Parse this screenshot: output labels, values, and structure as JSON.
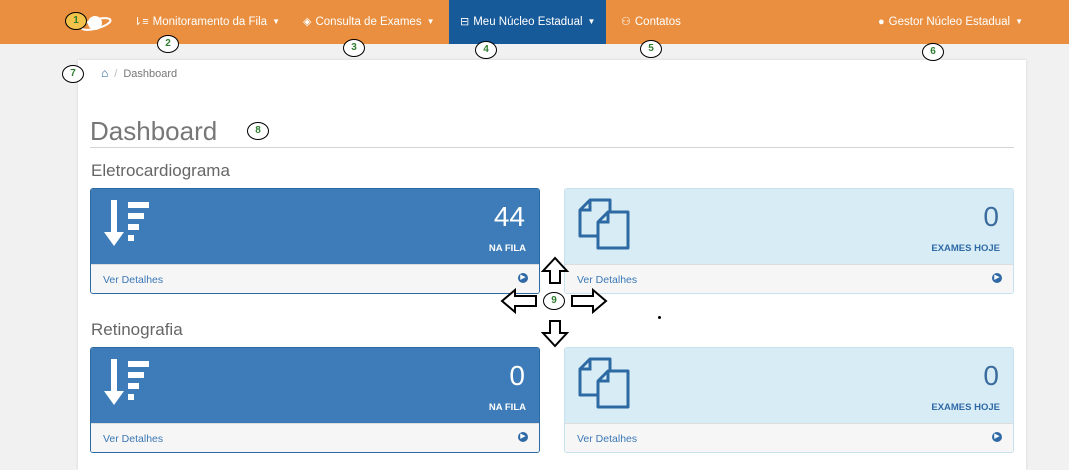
{
  "colors": {
    "navbar": "#e98f3f",
    "nav_active": "#175a99",
    "card_blue": "#3d7cb8",
    "card_light": "#d8ecf5",
    "link": "#3b78b6"
  },
  "navbar": {
    "logo_icon": "planet-logo-icon",
    "items": [
      {
        "label": "Monitoramento da Fila",
        "icon": "sort-down-icon",
        "dropdown": true
      },
      {
        "label": "Consulta de Exames",
        "icon": "layers-icon",
        "dropdown": true
      },
      {
        "label": "Meu Núcleo Estadual",
        "icon": "tray-icon",
        "dropdown": true,
        "active": true
      },
      {
        "label": "Contatos",
        "icon": "users-icon",
        "dropdown": false
      }
    ],
    "user": {
      "label": "Gestor Núcleo Estadual",
      "icon": "user-icon",
      "dropdown": true
    }
  },
  "breadcrumb": {
    "home_icon": "home-icon",
    "separator": "/",
    "current": "Dashboard"
  },
  "page": {
    "title": "Dashboard"
  },
  "sections": [
    {
      "title": "Eletrocardiograma",
      "queue": {
        "value": "44",
        "caption": "NA FILA",
        "link": "Ver Detalhes"
      },
      "today": {
        "value": "0",
        "caption": "EXAMES HOJE",
        "link": "Ver Detalhes"
      }
    },
    {
      "title": "Retinografia",
      "queue": {
        "value": "0",
        "caption": "NA FILA",
        "link": "Ver Detalhes"
      },
      "today": {
        "value": "0",
        "caption": "EXAMES HOJE",
        "link": "Ver Detalhes"
      }
    }
  ],
  "annotations": [
    "1",
    "2",
    "3",
    "4",
    "5",
    "6",
    "7",
    "8",
    "9"
  ]
}
